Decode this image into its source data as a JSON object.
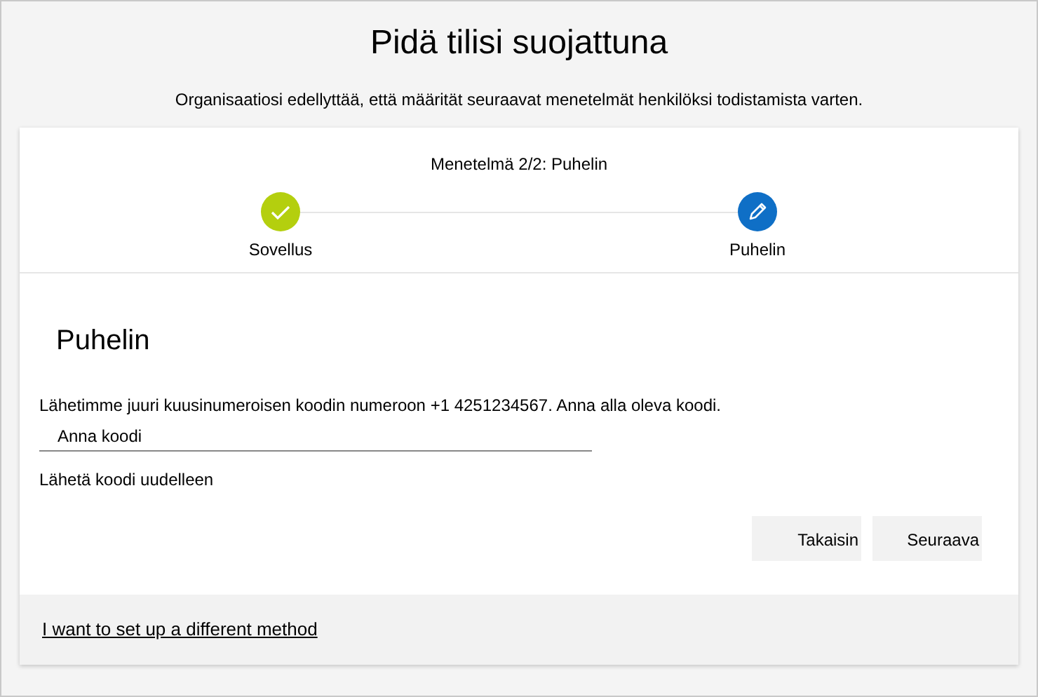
{
  "page": {
    "title": "Pidä tilisi suojattuna",
    "subtitle": "Organisaatiosi edellyttää, että määrität seuraavat menetelmät henkilöksi todistamista varten."
  },
  "progress": {
    "caption": "Menetelmä 2/2: Puhelin",
    "steps": [
      {
        "label": "Sovellus",
        "kind": "done"
      },
      {
        "label": "Puhelin",
        "kind": "current"
      }
    ]
  },
  "form": {
    "heading": "Puhelin",
    "instructions": "Lähetimme juuri kuusinumeroisen koodin numeroon +1 4251234567. Anna alla oleva koodi.",
    "code_field": {
      "placeholder": "Anna koodi"
    },
    "resend_link": "Lähetä koodi uudelleen",
    "buttons": [
      "Takaisin",
      "Seuraava"
    ]
  },
  "footer": {
    "link": "I want to set up a different method"
  }
}
